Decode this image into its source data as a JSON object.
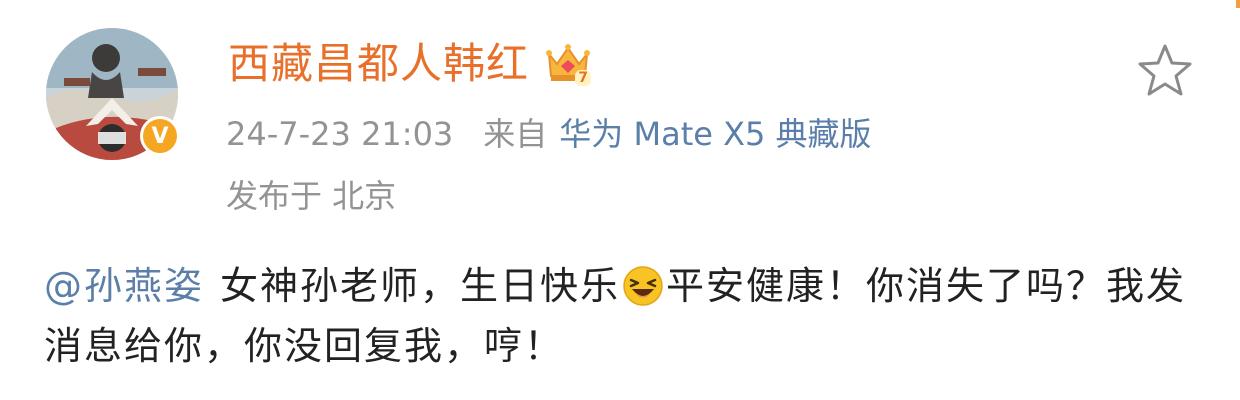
{
  "post": {
    "username": "西藏昌都人韩红",
    "crown_level": "7",
    "verified_mark": "V",
    "timestamp": "24-7-23 21:03",
    "from_label": "来自",
    "device": "华为 Mate X5 典藏版",
    "location": "发布于 北京",
    "mention": "@孙燕姿",
    "text_part1": "女神孙老师，生日快乐",
    "text_part2": "平安健康！你消失了吗？我发消息给你，你没回复我，哼！"
  },
  "icons": {
    "avatar": "avatar-image",
    "verified": "verified-icon",
    "crown": "crown-icon",
    "favorite": "star-icon",
    "emoji": "laughing-emoji-icon"
  },
  "colors": {
    "username": "#e8702a",
    "link": "#5b7fa8",
    "meta": "#939393",
    "verified": "#f5a623"
  }
}
